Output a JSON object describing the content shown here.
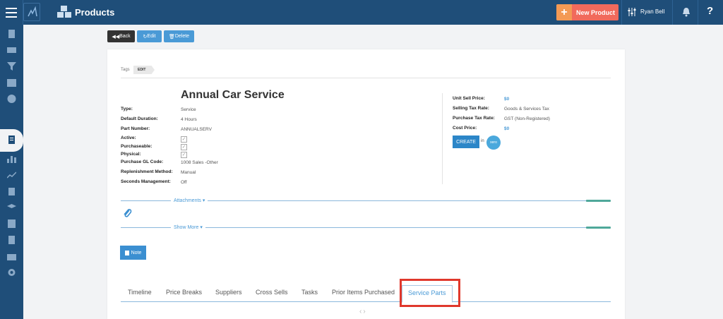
{
  "header": {
    "page_title": "Products",
    "new_product_label": "New Product",
    "user_name": "Ryan Bell",
    "help_label": "?"
  },
  "toolbar": {
    "back_label": "Back",
    "edit_label": "Edit",
    "delete_label": "Delete"
  },
  "tags": {
    "label": "Tags",
    "edit_label": "EDIT"
  },
  "product": {
    "title": "Annual Car Service",
    "fields": [
      {
        "label": "Type:",
        "value": "Service"
      },
      {
        "label": "Default Duration:",
        "value": "4 Hours"
      },
      {
        "label": "Part Number:",
        "value": "ANNUALSERV"
      },
      {
        "label": "Active:",
        "value": ""
      },
      {
        "label": "Purchaseable:",
        "value": ""
      },
      {
        "label": "Physical:",
        "value": ""
      },
      {
        "label": "Purchase GL Code:",
        "value": "1008 Sales -Other"
      },
      {
        "label": "Replenishment Method:",
        "value": "Manual"
      },
      {
        "label": "Seconds Management:",
        "value": "Off"
      }
    ],
    "pricing": [
      {
        "label": "Unit Sell Price:",
        "value": "$0"
      },
      {
        "label": "Selling Tax Rate:",
        "value": "Goods & Services Tax"
      },
      {
        "label": "Purchase Tax Rate:",
        "value": "GST (Non-Registered)"
      },
      {
        "label": "Cost Price:",
        "value": "$0"
      }
    ],
    "create_label": "CREATE",
    "in_label": "in",
    "xero_label": "xero"
  },
  "sections": {
    "attachments_label": "Attachments",
    "show_more_label": "Show More"
  },
  "note_label": "Note",
  "tabs": [
    {
      "label": "Timeline"
    },
    {
      "label": "Price Breaks"
    },
    {
      "label": "Suppliers"
    },
    {
      "label": "Cross Sells"
    },
    {
      "label": "Tasks"
    },
    {
      "label": "Prior Items Purchased"
    },
    {
      "label": "Service Parts",
      "active": true
    }
  ],
  "colors": {
    "header_bg": "#1f4e79",
    "accent": "#4a9ad6",
    "new_product": "#f16a5c",
    "highlight": "#e0382c"
  }
}
